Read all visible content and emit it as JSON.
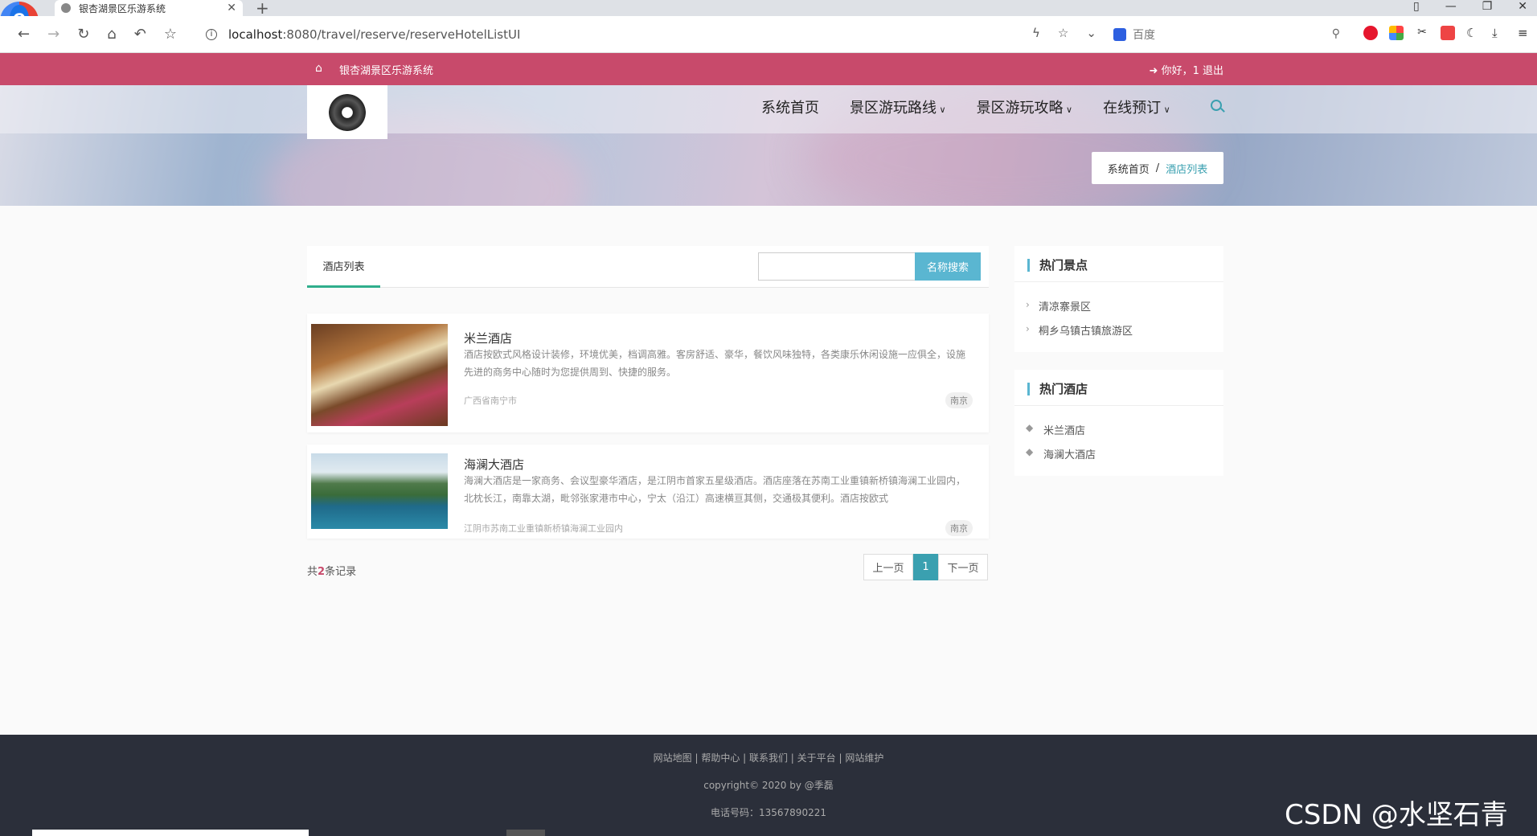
{
  "browser": {
    "tab_title": "银杏湖景区乐游系统",
    "url_host": "localhost",
    "url_path": ":8080/travel/reserve/reserveHotelListUI",
    "search_engine": "百度"
  },
  "topbar": {
    "site_name": "银杏湖景区乐游系统",
    "greeting": "你好，1",
    "logout": "退出"
  },
  "menu": {
    "home": "系统首页",
    "routes": "景区游玩路线",
    "guides": "景区游玩攻略",
    "booking": "在线预订"
  },
  "breadcrumb": {
    "home": "系统首页",
    "sep": "/",
    "current": "酒店列表"
  },
  "list": {
    "tab": "酒店列表",
    "search_button": "名称搜索",
    "search_value": "",
    "hotels": [
      {
        "name": "米兰酒店",
        "desc": "酒店按欧式风格设计装修，环境优美，档调高雅。客房舒适、豪华，餐饮风味独特，各类康乐休闲设施一应俱全，设施先进的商务中心随时为您提供周到、快捷的服务。",
        "addr": "广西省南宁市",
        "city": "南京"
      },
      {
        "name": "海澜大酒店",
        "desc": "海澜大酒店是一家商务、会议型豪华酒店，是江阴市首家五星级酒店。酒店座落在苏南工业重镇新桥镇海澜工业园内，北枕长江，南靠太湖，毗邻张家港市中心，宁太（沿江）高速横亘其侧，交通极其便利。酒店按欧式",
        "addr": "江阴市苏南工业重镇新桥镇海澜工业园内",
        "city": "南京"
      }
    ],
    "total_prefix": "共",
    "total_count": "2",
    "total_suffix": "条记录",
    "pager": {
      "prev": "上一页",
      "current": "1",
      "next": "下一页"
    }
  },
  "sidebar": {
    "spots_title": "热门景点",
    "spots": [
      "清凉寨景区",
      "桐乡乌镇古镇旅游区"
    ],
    "hotels_title": "热门酒店",
    "hotels": [
      "米兰酒店",
      "海澜大酒店"
    ]
  },
  "footer": {
    "links": "网站地图 | 帮助中心 | 联系我们 | 关于平台 | 网站维护",
    "copyright": "copyright© 2020 by @季磊",
    "phone": "电话号码：13567890221"
  },
  "watermark": "CSDN @水坚石青",
  "colors": {
    "accent": "#3aa0b0",
    "topbar": "#c84a6b",
    "footer": "#2b2f3a"
  }
}
